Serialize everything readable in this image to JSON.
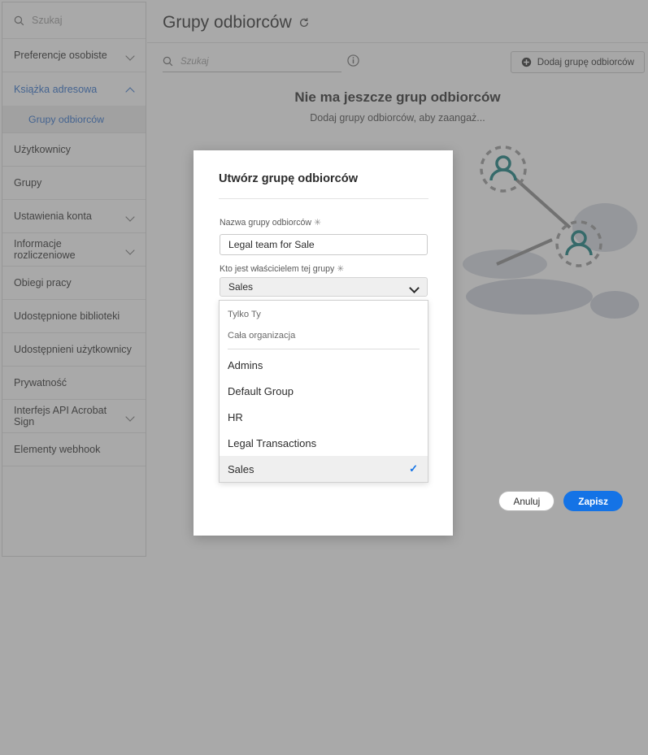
{
  "sidebar": {
    "search_placeholder": "Szukaj",
    "search_icon": "search-icon",
    "items": [
      {
        "label": "Preferencje osobiste",
        "has_chevron": true,
        "active": false
      },
      {
        "label": "Książka adresowa",
        "has_chevron": true,
        "active": true
      },
      {
        "label": "Użytkownicy",
        "has_chevron": false,
        "active": false
      },
      {
        "label": "Grupy",
        "has_chevron": false,
        "active": false
      },
      {
        "label": "Ustawienia konta",
        "has_chevron": true,
        "active": false
      },
      {
        "label": "Informacje rozliczeniowe",
        "has_chevron": true,
        "active": false
      },
      {
        "label": "Obiegi pracy",
        "has_chevron": false,
        "active": false
      },
      {
        "label": "Udostępnione biblioteki",
        "has_chevron": false,
        "active": false
      },
      {
        "label": "Udostępnieni użytkownicy",
        "has_chevron": false,
        "active": false
      },
      {
        "label": "Prywatność",
        "has_chevron": false,
        "active": false
      },
      {
        "label": "Interfejs API Acrobat Sign",
        "has_chevron": true,
        "active": false
      },
      {
        "label": "Elementy webhook",
        "has_chevron": false,
        "active": false
      }
    ],
    "sub_item": {
      "label": "Grupy odbiorców",
      "active": true
    }
  },
  "header": {
    "title": "Grupy odbiorców",
    "refresh_icon": "refresh-icon"
  },
  "toolbar": {
    "search_placeholder": "Szukaj",
    "search_icon": "search-icon",
    "info_icon": "info-icon",
    "add_button_label": "Dodaj grupę odbiorców",
    "add_button_icon": "plus-circle-icon"
  },
  "empty_state": {
    "title": "Nie ma jeszcze grup odbiorców",
    "subtitle": "Dodaj grupy odbiorców, aby zaangaż..."
  },
  "modal": {
    "title": "Utwórz grupę odbiorców",
    "name_field": {
      "label": "Nazwa grupy odbiorców",
      "required_marker": "✳",
      "value": "Legal team for Sale"
    },
    "owner_field": {
      "label": "Kto jest właścicielem tej grupy",
      "required_marker": "✳",
      "selected": "Sales",
      "chevron_icon": "chevron-down-icon"
    },
    "dropdown": {
      "special_options": [
        "Tylko Ty",
        "Cała organizacja"
      ],
      "options": [
        {
          "label": "Admins",
          "selected": false
        },
        {
          "label": "Default Group",
          "selected": false
        },
        {
          "label": "HR",
          "selected": false
        },
        {
          "label": "Legal Transactions",
          "selected": false
        },
        {
          "label": "Sales",
          "selected": true
        }
      ],
      "check_glyph": "✓"
    },
    "cancel_label": "Anuluj",
    "save_label": "Zapisz"
  },
  "colors": {
    "accent_blue": "#1473e6",
    "link_blue": "#2c6ecb",
    "illustration_teal": "#0f7b7b",
    "overlay": "rgba(90,90,90,0.52)"
  }
}
